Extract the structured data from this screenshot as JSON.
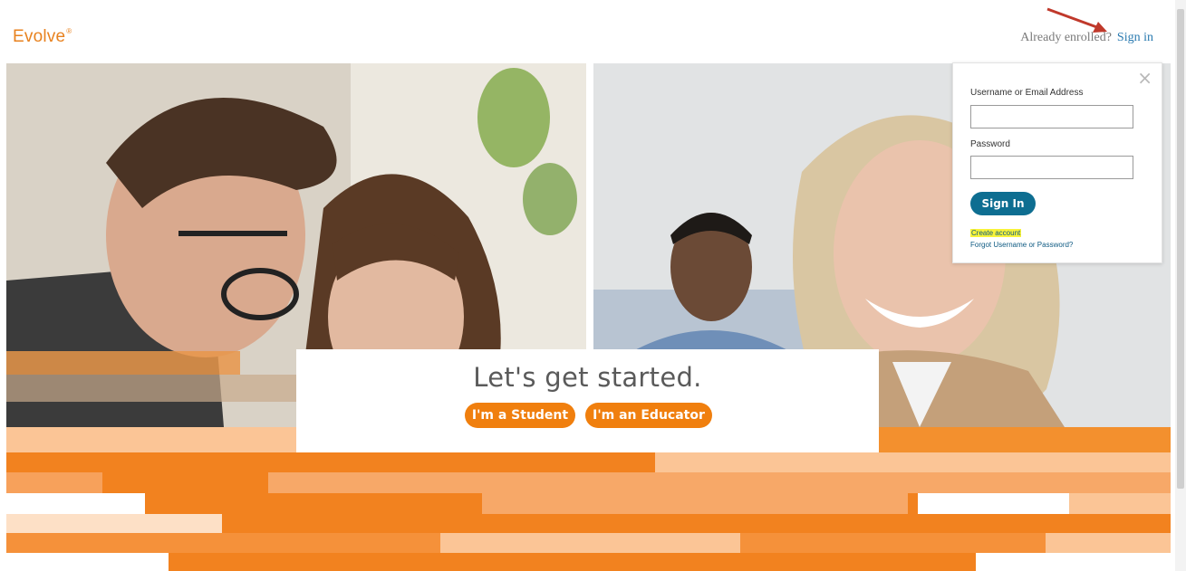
{
  "header": {
    "logo": "Evolve",
    "logo_mark": "®",
    "enrolled_text": "Already enrolled?",
    "signin_link": "Sign in"
  },
  "hero": {
    "headline": "Let's get started.",
    "student_button": "I'm a Student",
    "educator_button": "I'm an Educator"
  },
  "signin_panel": {
    "close_glyph": "×",
    "username_label": "Username or Email Address",
    "username_value": "",
    "password_label": "Password",
    "password_value": "",
    "signin_button": "Sign In",
    "create_account": "Create account",
    "forgot": "Forgot Username or Password?"
  },
  "colors": {
    "brand_orange": "#f07f0e",
    "panel_button": "#0e6e91",
    "link_blue": "#2a7ab0",
    "highlight": "#f8f33a"
  }
}
